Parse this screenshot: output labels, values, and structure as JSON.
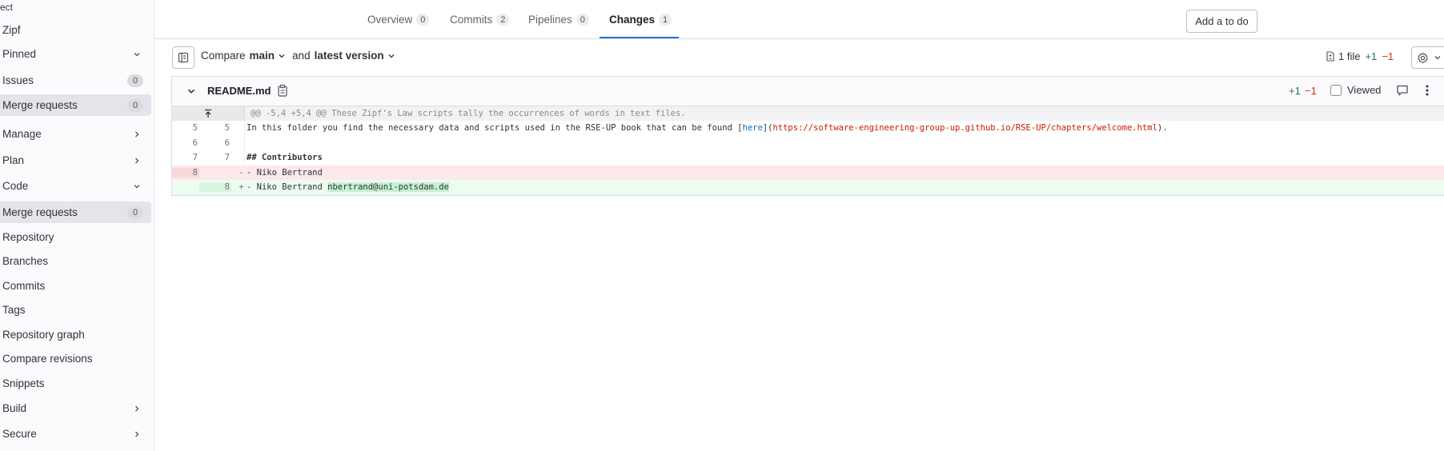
{
  "sidebar": {
    "top_label": "ect",
    "items": [
      {
        "label": "Zipf"
      },
      {
        "label": "Pinned"
      },
      {
        "label": "Issues",
        "count": "0"
      },
      {
        "label": "Merge requests",
        "count": "0"
      },
      {
        "label": "Manage"
      },
      {
        "label": "Plan"
      },
      {
        "label": "Code"
      },
      {
        "label": "Merge requests",
        "count": "0"
      },
      {
        "label": "Repository"
      },
      {
        "label": "Branches"
      },
      {
        "label": "Commits"
      },
      {
        "label": "Tags"
      },
      {
        "label": "Repository graph"
      },
      {
        "label": "Compare revisions"
      },
      {
        "label": "Snippets"
      },
      {
        "label": "Build"
      },
      {
        "label": "Secure"
      }
    ]
  },
  "tabs": [
    {
      "label": "Overview",
      "count": "0"
    },
    {
      "label": "Commits",
      "count": "2"
    },
    {
      "label": "Pipelines",
      "count": "0"
    },
    {
      "label": "Changes",
      "count": "1"
    }
  ],
  "todo_button": "Add a to do",
  "compare": {
    "prefix": "Compare",
    "base": "main",
    "middle": "and",
    "head": "latest version"
  },
  "files_stat": {
    "label": "1 file",
    "added": "+1",
    "removed": "−1"
  },
  "file": {
    "name": "README.md",
    "added": "+1",
    "removed": "−1",
    "viewed_label": "Viewed"
  },
  "diff": {
    "hunk": "@@ -5,4 +5,4 @@ These Zipf's Law scripts tally the occurrences of words in text files.",
    "line5": {
      "old": "5",
      "new": "5",
      "pre": "In this folder you find the necessary data and scripts used in the RSE-UP book that can be found [",
      "link": "here",
      "mid": "](",
      "url": "https://software-engineering-group-up.github.io/RSE-UP/chapters/welcome.html",
      "post": ")."
    },
    "line6": {
      "old": "6",
      "new": "6",
      "text": ""
    },
    "line7": {
      "old": "7",
      "new": "7",
      "text": "## Contributors"
    },
    "line_del": {
      "old": "8",
      "sign": "-",
      "text": "- Niko Bertrand"
    },
    "line_add": {
      "new": "8",
      "sign": "+",
      "text": "- Niko Bertrand ",
      "highlight": "nbertrand@uni-potsdam.de"
    }
  }
}
